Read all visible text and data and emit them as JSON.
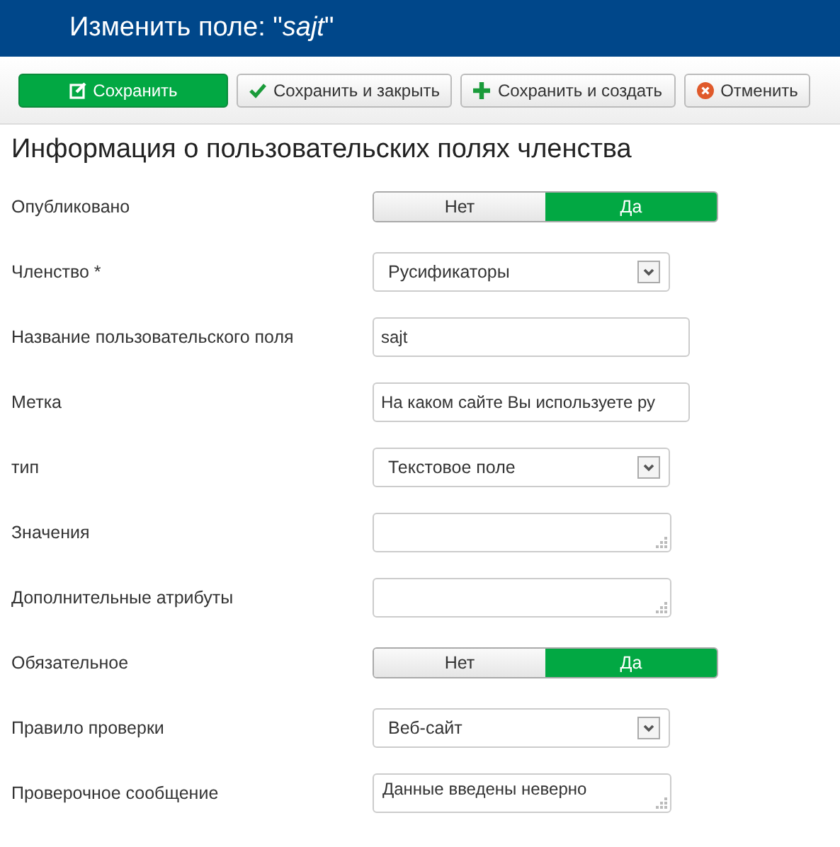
{
  "header": {
    "title": "Изменить поле: \"*sajt*\""
  },
  "toolbar": [
    {
      "label": "Сохранить",
      "kind": "primary"
    },
    {
      "label": "Сохранить и закрыть",
      "kind": "check"
    },
    {
      "label": "Сохранить и создать",
      "kind": "plus"
    },
    {
      "label": "Отменить",
      "kind": "cancel"
    }
  ],
  "section_title": "Информация о пользовательских полях членства",
  "fields": [
    {
      "label": "Опубликовано",
      "kind": "toggle",
      "options": [
        {
          "label": "Нет",
          "selected": false
        },
        {
          "label": "Да",
          "selected": true
        }
      ]
    },
    {
      "label": "Членство *",
      "kind": "select",
      "value": "Русификаторы"
    },
    {
      "label": "Название пользовательского поля",
      "kind": "input",
      "value": "sajt"
    },
    {
      "label": "Метка",
      "kind": "input",
      "value": "На каком сайте Вы используете ру"
    },
    {
      "label": "тип",
      "kind": "select",
      "value": "Текстовое поле"
    },
    {
      "label": "Значения",
      "kind": "textarea"
    },
    {
      "label": "Дополнительные атрибуты",
      "kind": "textarea"
    },
    {
      "label": "Обязательное",
      "kind": "toggle",
      "options": [
        {
          "label": "Нет",
          "selected": false
        },
        {
          "label": "Да",
          "selected": true
        }
      ]
    },
    {
      "label": "Правило проверки",
      "kind": "select",
      "value": "Веб-сайт"
    },
    {
      "label": "Проверочное сообщение",
      "kind": "textarea",
      "value": "Данные введены неверно"
    }
  ]
}
